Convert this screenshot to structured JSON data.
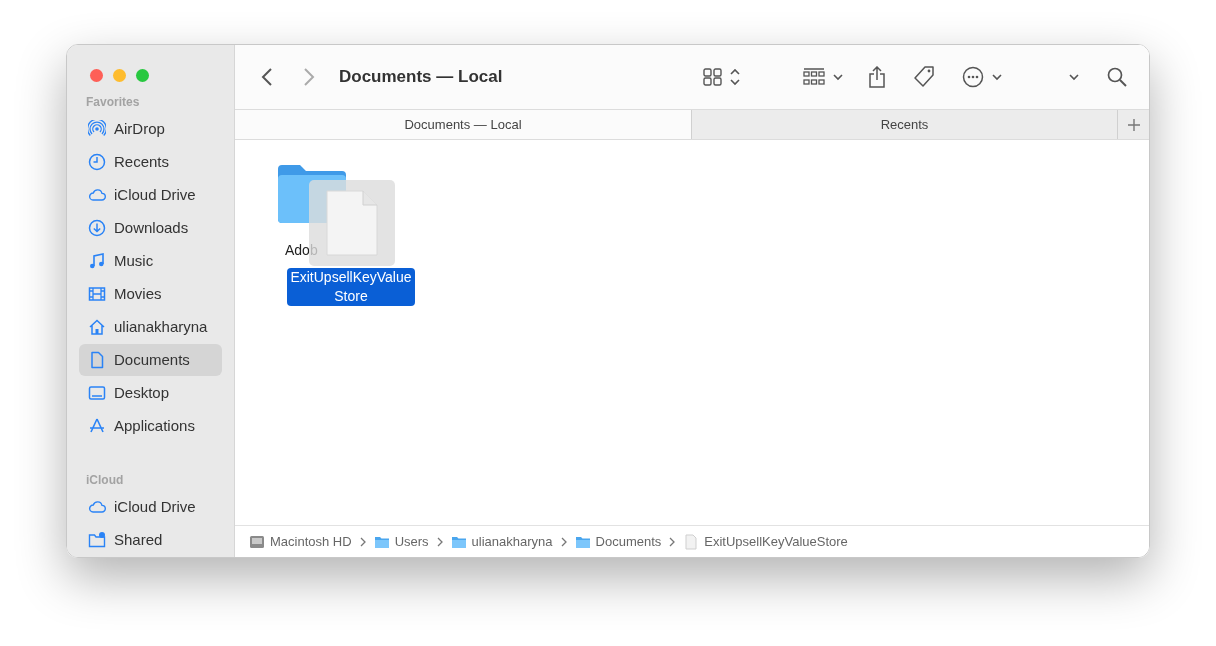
{
  "window": {
    "title": "Documents — Local"
  },
  "sidebar": {
    "sections": [
      {
        "header": "Favorites",
        "items": [
          {
            "label": "AirDrop",
            "kind": "airdrop",
            "selected": false
          },
          {
            "label": "Recents",
            "kind": "clock",
            "selected": false
          },
          {
            "label": "iCloud Drive",
            "kind": "cloud",
            "selected": false
          },
          {
            "label": "Downloads",
            "kind": "download",
            "selected": false
          },
          {
            "label": "Music",
            "kind": "music",
            "selected": false
          },
          {
            "label": "Movies",
            "kind": "film",
            "selected": false
          },
          {
            "label": "ulianakharyna",
            "kind": "home",
            "selected": false
          },
          {
            "label": "Documents",
            "kind": "doc",
            "selected": true
          },
          {
            "label": "Desktop",
            "kind": "desktop",
            "selected": false
          },
          {
            "label": "Applications",
            "kind": "apps",
            "selected": false
          }
        ]
      },
      {
        "header": "iCloud",
        "items": [
          {
            "label": "iCloud Drive",
            "kind": "cloud",
            "selected": false
          },
          {
            "label": "Shared",
            "kind": "shared",
            "selected": false
          }
        ]
      }
    ]
  },
  "tabs": [
    {
      "label": "Documents — Local",
      "selected": true
    },
    {
      "label": "Recents",
      "selected": false
    }
  ],
  "files": [
    {
      "name": "Adob",
      "kind": "folder",
      "selected": false
    },
    {
      "name": "ExitUpsellKeyValueStore",
      "kind": "file",
      "selected": true
    }
  ],
  "path_bar": [
    {
      "label": "Macintosh HD",
      "kind": "disk"
    },
    {
      "label": "Users",
      "kind": "folder"
    },
    {
      "label": "ulianakharyna",
      "kind": "folder"
    },
    {
      "label": "Documents",
      "kind": "folder"
    },
    {
      "label": "ExitUpsellKeyValueStore",
      "kind": "file"
    }
  ]
}
